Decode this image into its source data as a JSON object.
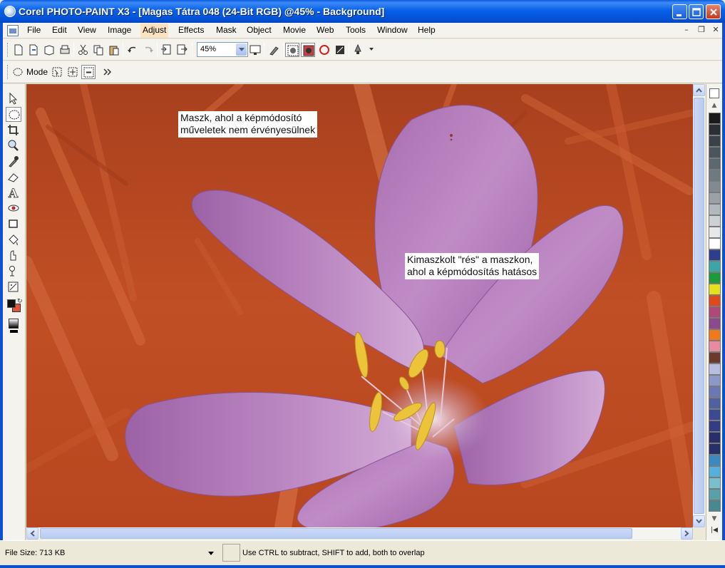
{
  "window": {
    "title": "Corel PHOTO-PAINT X3 - [Magas Tátra 048 (24-Bit RGB) @45% - Background]"
  },
  "menu": {
    "items": [
      "File",
      "Edit",
      "View",
      "Image",
      "Adjust",
      "Effects",
      "Mask",
      "Object",
      "Movie",
      "Web",
      "Tools",
      "Window",
      "Help"
    ],
    "active": "Adjust"
  },
  "toolbar": {
    "zoom": "45%"
  },
  "property_bar": {
    "mode_label": "Mode"
  },
  "canvas": {
    "annotation_mask": [
      "Maszk, ahol a képmódosító",
      "műveletek nem érvényesülnek"
    ],
    "annotation_gap": [
      "Kimaszkolt \"rés\" a maszkon,",
      "ahol a képmódosítás hatásos"
    ]
  },
  "status": {
    "file_size": "File Size: 713 KB",
    "hint": "Use CTRL to subtract, SHIFT to add, both to overlap"
  },
  "palette": {
    "colors": [
      "#1a1a1a",
      "#2b2f33",
      "#3a4248",
      "#4a555c",
      "#5c676e",
      "#6e7a80",
      "#808a90",
      "#9aa2a6",
      "#b2b8bb",
      "#cdd1d3",
      "#e6e8e9",
      "#ffffff",
      "#2c3e8c",
      "#3aa6a6",
      "#1c9a3c",
      "#e6e21a",
      "#e04a1a",
      "#b04878",
      "#8a4a8c",
      "#f07a1a",
      "#e88aa0",
      "#6a3a2a",
      "#b8bede",
      "#8c98c8",
      "#6a78b4",
      "#5060a0",
      "#3c4a94",
      "#343c84",
      "#2a2e6a",
      "#28306a",
      "#3a8ac0",
      "#56b0dc",
      "#78c0cc",
      "#5aa0a8",
      "#4a8890"
    ]
  }
}
